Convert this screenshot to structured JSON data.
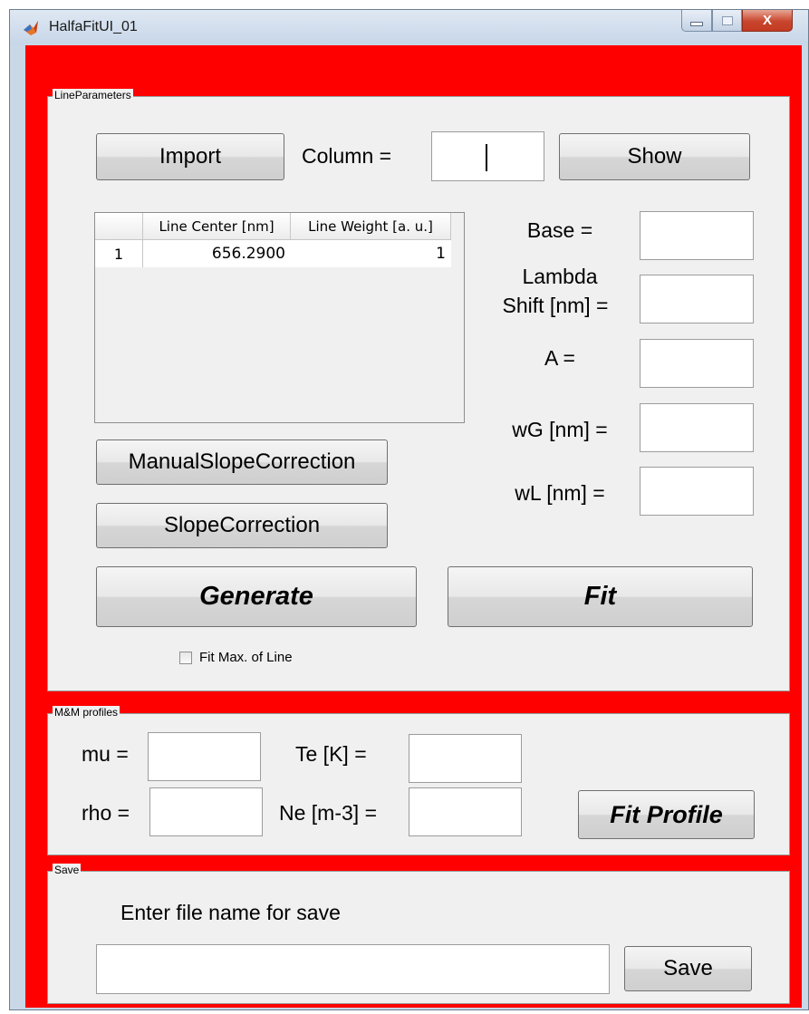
{
  "window": {
    "title": "HalfaFitUI_01",
    "app_icon": "matlab-icon",
    "controls": {
      "minimize": "minimize-icon",
      "maximize": "maximize-icon",
      "close": "close-icon",
      "close_glyph": "X"
    }
  },
  "colors": {
    "background": "#ff0000",
    "panel": "#f0f0f0",
    "close_button": "#c43a22"
  },
  "line_parameters": {
    "title": "LineParameters",
    "import_label": "Import",
    "column_label": "Column =",
    "column_value": "",
    "show_label": "Show",
    "table": {
      "columns": [
        "",
        "Line Center [nm]",
        "Line Weight [a. u.]"
      ],
      "rows": [
        {
          "index": "1",
          "center": "656.2900",
          "weight": "1"
        }
      ]
    },
    "base_label": "Base =",
    "lambda_label_line1": "Lambda",
    "lambda_label_line2": "Shift [nm] =",
    "a_label": "A =",
    "wg_label": "wG [nm] =",
    "wl_label": "wL [nm] =",
    "manual_slope_label": "ManualSlopeCorrection",
    "slope_label": "SlopeCorrection",
    "generate_label": "Generate",
    "fit_label": "Fit",
    "fit_max_label": "Fit Max. of Line",
    "fit_max_checked": false
  },
  "mm_profiles": {
    "title": "M&M profiles",
    "mu_label": "mu =",
    "rho_label": "rho =",
    "te_label": "Te [K] =",
    "ne_label": "Ne [m-3] =",
    "fit_profile_label": "Fit Profile"
  },
  "save": {
    "title": "Save",
    "prompt": "Enter file name for save",
    "filename_value": "",
    "save_label": "Save"
  }
}
